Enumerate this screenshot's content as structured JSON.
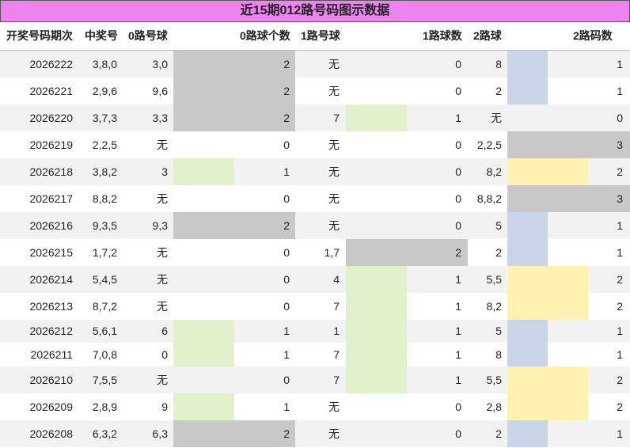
{
  "title": "近15期012路号码图示数据",
  "headers": [
    "开奖号码期次",
    "中奖号",
    "0路号球",
    "0路球个数",
    "1路号球",
    "1路球数",
    "2路球",
    "2路码数"
  ],
  "colors": {
    "title_bg": "#ee82ee",
    "gray": "#c8c8c8",
    "green": "#e2f0cc",
    "blue": "#c9d5e8",
    "yellow": "#fff2b0",
    "stripe": "#f2f2f2"
  },
  "chart_data": {
    "type": "table",
    "title": "近15期012路号码图示数据",
    "columns": [
      "开奖号码期次",
      "中奖号",
      "0路号球",
      "0路球个数",
      "1路号球",
      "1路球数",
      "2路球",
      "2路码数"
    ],
    "rows": [
      [
        "2026222",
        "3,8,0",
        "3,0",
        2,
        "无",
        0,
        "8",
        1
      ],
      [
        "2026221",
        "2,9,6",
        "9,6",
        2,
        "无",
        0,
        "2",
        1
      ],
      [
        "2026220",
        "3,7,3",
        "3,3",
        2,
        "7",
        1,
        "无",
        0
      ],
      [
        "2026219",
        "2,2,5",
        "无",
        0,
        "无",
        0,
        "2,2,5",
        3
      ],
      [
        "2026218",
        "3,8,2",
        "3",
        1,
        "无",
        0,
        "8,2",
        2
      ],
      [
        "2026217",
        "8,8,2",
        "无",
        0,
        "无",
        0,
        "8,8,2",
        3
      ],
      [
        "2026216",
        "9,3,5",
        "9,3",
        2,
        "无",
        0,
        "5",
        1
      ],
      [
        "2026215",
        "1,7,2",
        "无",
        0,
        "1,7",
        2,
        "2",
        1
      ],
      [
        "2026214",
        "5,4,5",
        "无",
        0,
        "4",
        1,
        "5,5",
        2
      ],
      [
        "2026213",
        "8,7,2",
        "无",
        0,
        "7",
        1,
        "8,2",
        2
      ],
      [
        "2026212",
        "5,6,1",
        "6",
        1,
        "1",
        1,
        "5",
        1
      ],
      [
        "2026211",
        "7,0,8",
        "0",
        1,
        "7",
        1,
        "8",
        1
      ],
      [
        "2026210",
        "7,5,5",
        "无",
        0,
        "7",
        1,
        "5,5",
        2
      ],
      [
        "2026209",
        "2,8,9",
        "9",
        1,
        "无",
        0,
        "2,8",
        2
      ],
      [
        "2026208",
        "6,3,2",
        "6,3",
        2,
        "无",
        0,
        "2",
        1
      ]
    ]
  }
}
